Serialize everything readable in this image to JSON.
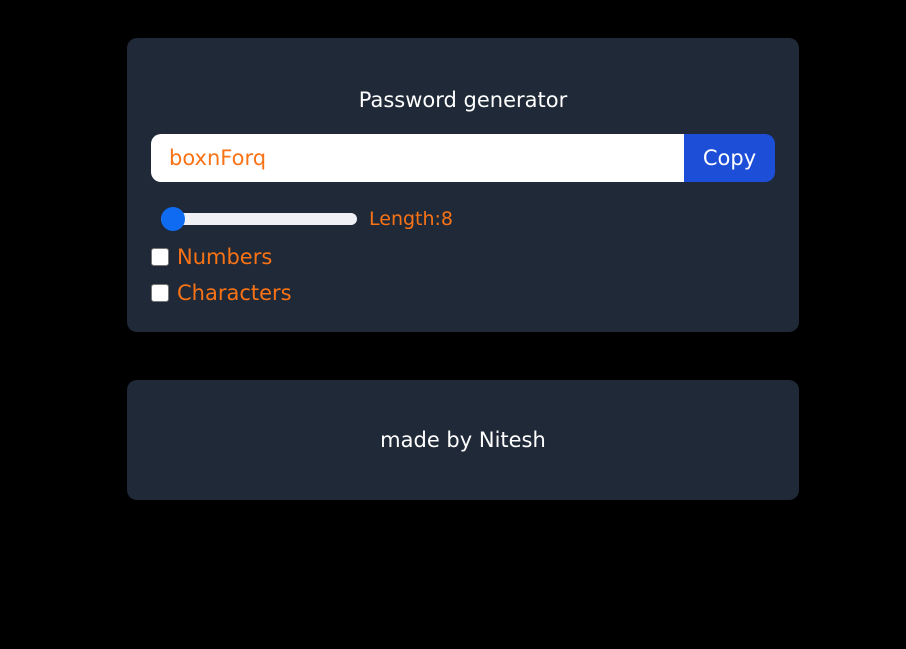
{
  "generator": {
    "title": "Password generator",
    "password_value": "boxnForq",
    "copy_label": "Copy",
    "length_label": "Length:8",
    "length_value": 8,
    "numbers_label": "Numbers",
    "numbers_checked": false,
    "characters_label": "Characters",
    "characters_checked": false
  },
  "footer": {
    "text": "made by Nitesh"
  },
  "colors": {
    "background": "#000000",
    "card": "#1f2937",
    "accent_text": "#f97316",
    "button": "#1d4ed8",
    "slider_thumb": "#0f6cf2"
  }
}
